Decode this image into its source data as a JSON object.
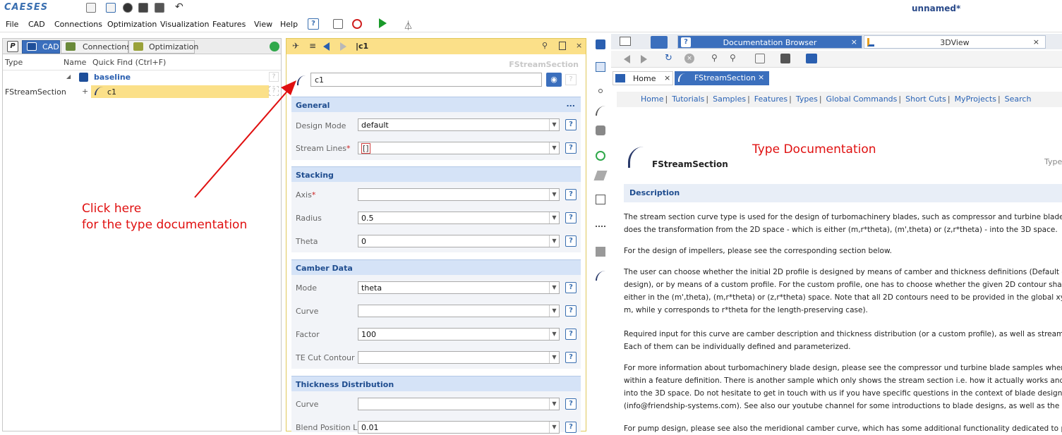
{
  "app": {
    "logo": "CAESES",
    "title": "unnamed*"
  },
  "menu": [
    "File",
    "CAD",
    "Connections",
    "Optimization",
    "Visualization",
    "Features",
    "View",
    "Help"
  ],
  "left": {
    "tabs": {
      "p": "P",
      "cad": "CAD",
      "connections": "Connections",
      "optimization": "Optimization"
    },
    "columns": {
      "type": "Type",
      "name": "Name",
      "quickfind": "Quick Find (Ctrl+F)"
    },
    "tree": {
      "root": {
        "name": "baseline",
        "help": "?"
      },
      "child": {
        "type": "FStreamSection",
        "expander": "+",
        "name": "c1",
        "help": "?"
      }
    }
  },
  "editor": {
    "header": "|c1",
    "type_label": "FStreamSection",
    "name_value": "c1",
    "sections": [
      {
        "title": "General",
        "more": "...",
        "fields": [
          {
            "label": "Design Mode",
            "required": false,
            "value": "default"
          },
          {
            "label": "Stream Lines",
            "required": true,
            "value": "[]"
          }
        ]
      },
      {
        "title": "Stacking",
        "fields": [
          {
            "label": "Axis",
            "required": true,
            "value": ""
          },
          {
            "label": "Radius",
            "required": false,
            "value": "0.5"
          },
          {
            "label": "Theta",
            "required": false,
            "value": "0"
          }
        ]
      },
      {
        "title": "Camber Data",
        "fields": [
          {
            "label": "Mode",
            "required": false,
            "value": "theta"
          },
          {
            "label": "Curve",
            "required": false,
            "value": ""
          },
          {
            "label": "Factor",
            "required": false,
            "value": "100"
          },
          {
            "label": "TE Cut Contour",
            "required": false,
            "value": ""
          }
        ]
      },
      {
        "title": "Thickness Distribution",
        "fields": [
          {
            "label": "Curve",
            "required": false,
            "value": ""
          },
          {
            "label": "Blend Position LE",
            "required": false,
            "value": "0.01"
          }
        ]
      }
    ]
  },
  "right": {
    "tabs": {
      "doc": "Documentation Browser",
      "view3d": "3DView"
    },
    "inner_tabs": {
      "home": "Home",
      "fstream": "FStreamSection"
    },
    "nav_links": [
      "Home",
      "Tutorials",
      "Samples",
      "Features",
      "Types",
      "Global Commands",
      "Short Cuts",
      "MyProjects",
      "Search"
    ],
    "doc_title": "FStreamSection",
    "doc_type_cut": "Type",
    "description_header": "Description",
    "paragraphs": [
      "The stream section curve type is used for the design of turbomachinery blades, such as compressor and turbine blades. This cur",
      "does the transformation from the 2D space - which is either (m,r*theta), (m',theta) or (z,r*theta) - into the 3D space.",
      "For the design of impellers, please see the corresponding section below.",
      "The user can choose whether the initial 2D profile is designed by means of camber and thickness definitions (Default - mostly ",
      "design), or by means of a custom profile. For the custom profile, one has to choose whether the given 2D contour shall be interp",
      "either in the (m',theta), (m,r*theta) or (z,r*theta) space. Note that all 2D contours need to be provided in the global xy-space (",
      "m, while y corresponds to r*theta for the length-preserving case).",
      "Required input for this curve are camber description and thickness distribution (or a custom profile), as well as stream lines an",
      "Each of them can be individually defined and parameterized.",
      "For more information about turbomachinery blade design, please see the compressor und turbine blade samples where a stream",
      "within a feature definition. There is another sample which only shows the stream section i.e. how it actually works and how it ma",
      "into the 3D space. Do not hesitate to get in touch with us if you have specific questions in the context of blade design for engi",
      "(info@friendship-systems.com). See also our youtube channel for some introductions to blade designs, as well as the provided tut",
      "For pump design, please see also the meridional camber curve, which has some additional functionality dedicated to pumps."
    ]
  },
  "annotations": {
    "click_line1": "Click here",
    "click_line2": "for the type documentation",
    "type_doc": "Type Documentation"
  },
  "colors": {
    "accent": "#3b6fbd",
    "annotation": "#e01010",
    "editor_header": "#fbe089",
    "section_bg": "#d5e3f7"
  }
}
